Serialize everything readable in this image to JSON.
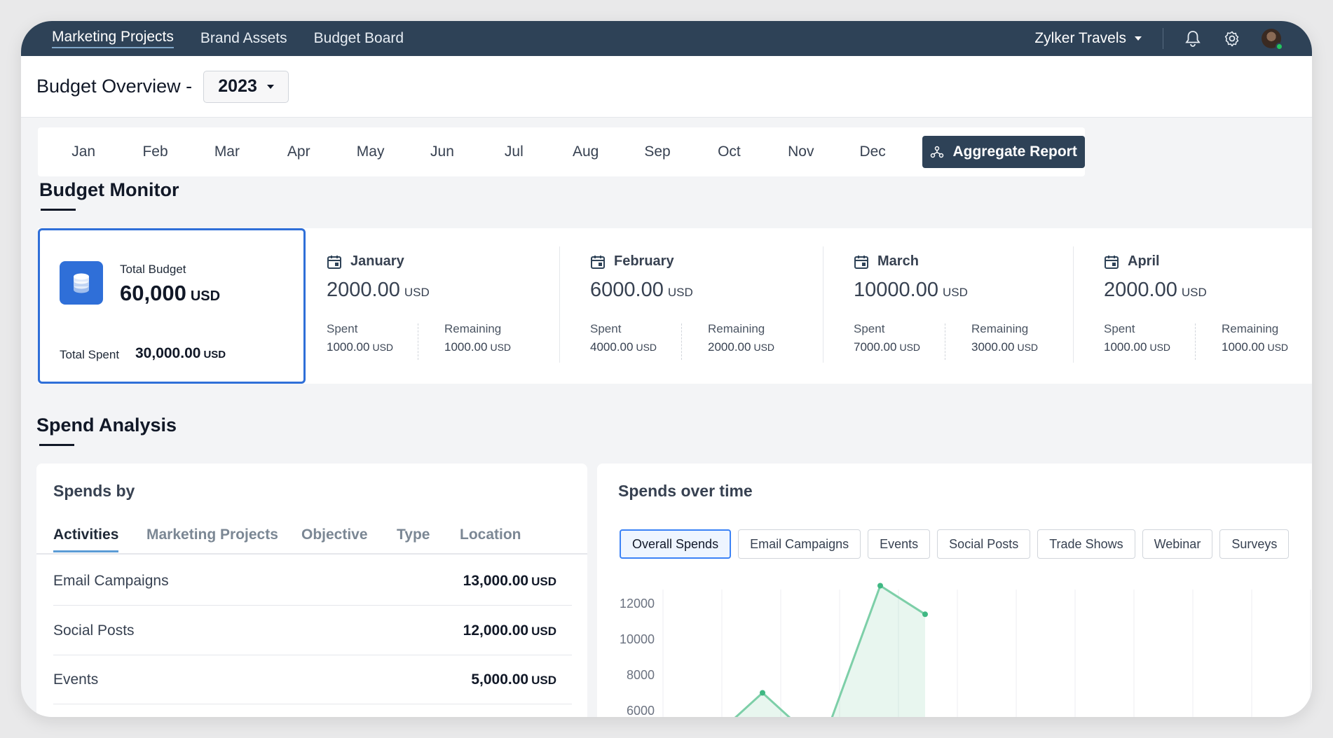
{
  "topnav": {
    "tabs": [
      "Marketing Projects",
      "Brand Assets",
      "Budget Board"
    ],
    "org": "Zylker Travels",
    "icons": [
      "bell-icon",
      "gear-icon",
      "avatar"
    ]
  },
  "header": {
    "title": "Budget Overview -",
    "year": "2023"
  },
  "months": [
    "Jan",
    "Feb",
    "Mar",
    "Apr",
    "May",
    "Jun",
    "Jul",
    "Aug",
    "Sep",
    "Oct",
    "Nov",
    "Dec"
  ],
  "aggregate_label": "Aggregate Report",
  "monitor": {
    "title": "Budget Monitor",
    "total_budget_label": "Total Budget",
    "total_budget_value": "60,000",
    "total_spent_label": "Total Spent",
    "total_spent_value": "30,000.00",
    "unit": "USD",
    "spent_label": "Spent",
    "remaining_label": "Remaining",
    "cards": [
      {
        "month": "January",
        "budget": "2000.00",
        "spent": "1000.00",
        "remaining": "1000.00"
      },
      {
        "month": "February",
        "budget": "6000.00",
        "spent": "4000.00",
        "remaining": "2000.00"
      },
      {
        "month": "March",
        "budget": "10000.00",
        "spent": "7000.00",
        "remaining": "3000.00"
      },
      {
        "month": "April",
        "budget": "2000.00",
        "spent": "1000.00",
        "remaining": "1000.00"
      }
    ]
  },
  "spend_analysis": {
    "title": "Spend Analysis",
    "spends_by": {
      "title": "Spends by",
      "tabs": [
        "Activities",
        "Marketing Projects",
        "Objective",
        "Type",
        "Location"
      ],
      "active_tab": "Activities",
      "rows": [
        {
          "label": "Email Campaigns",
          "amount": "13,000.00"
        },
        {
          "label": "Social Posts",
          "amount": "12,000.00"
        },
        {
          "label": "Events",
          "amount": "5,000.00"
        }
      ]
    },
    "spends_over_time": {
      "title": "Spends over time",
      "chips": [
        "Overall Spends",
        "Email Campaigns",
        "Events",
        "Social Posts",
        "Trade Shows",
        "Webinar",
        "Surveys"
      ],
      "active_chip": "Overall Spends"
    }
  },
  "colors": {
    "nav": "#2e4257",
    "accent": "#2f6fd8",
    "series": "#7dcfa8"
  },
  "chart_data": {
    "type": "area",
    "title": "Spends over time",
    "yticks": [
      12000,
      10000,
      8000,
      6000
    ],
    "ylim": [
      5500,
      13000
    ],
    "series": [
      {
        "values": [
          4000,
          7000,
          4000,
          13000,
          11400
        ]
      }
    ]
  }
}
